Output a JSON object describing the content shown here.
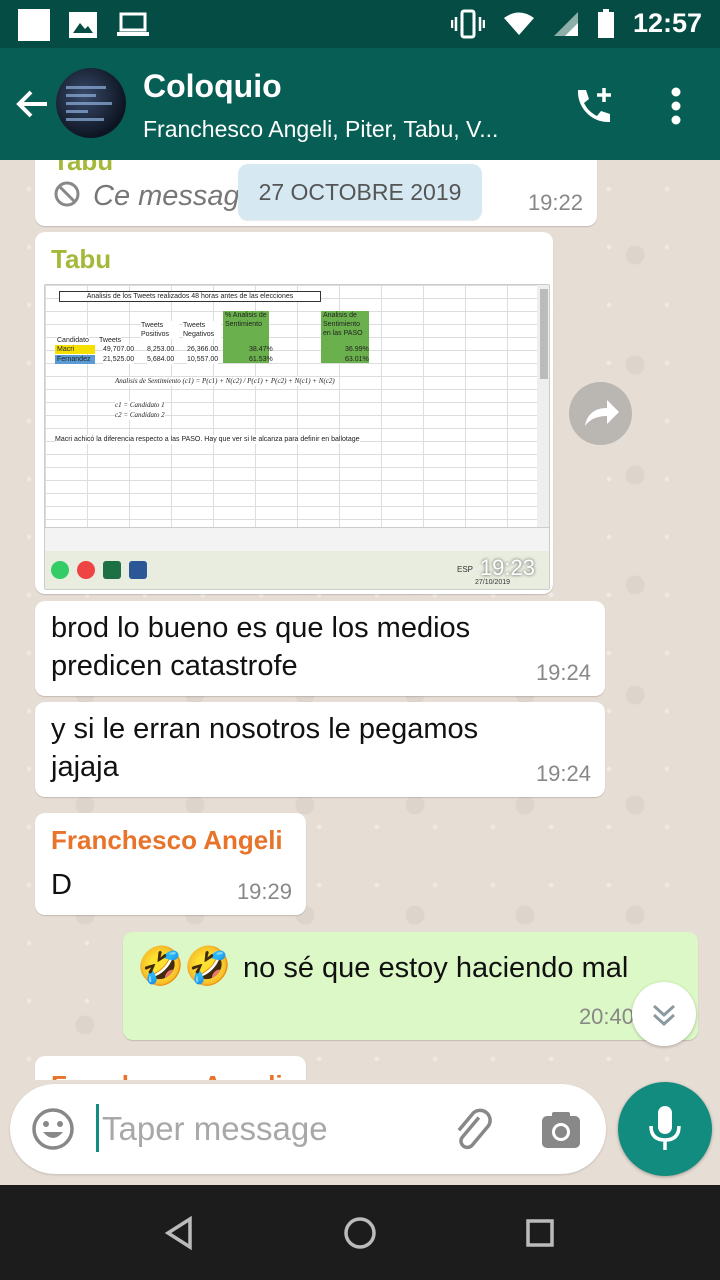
{
  "status_bar": {
    "time": "12:57"
  },
  "header": {
    "title": "Coloquio",
    "subtitle": "Franchesco Angeli, Piter, Tabu, V..."
  },
  "date_chip": "27 OCTOBRE 2019",
  "messages": [
    {
      "sender": "Tabu",
      "text": "Ce message a été supprimé",
      "time": "19:22",
      "deleted": true
    },
    {
      "sender": "Tabu",
      "type": "image",
      "time": "19:23",
      "image": {
        "title": "Analisis de los Tweets realizados 48 horas antes de las elecciones",
        "headers": [
          "Candidato",
          "Tweets",
          "Tweets Positivos",
          "Tweets Negativos",
          "% Analisis de Sentimiento",
          "Analisis de Sentimiento en las PASO"
        ],
        "rows": [
          [
            "Macri",
            "49,707.00",
            "8,253.00",
            "26,366.00",
            "38.47%",
            "36.99%"
          ],
          [
            "Fernandez",
            "21,525.00",
            "5,684.00",
            "10,557.00",
            "61.53%",
            "63.01%"
          ]
        ],
        "formula": "Analisis de Sentimiento (c1) = P(c1) + N(c2) / P(c1) + P(c2) + N(c1) + N(c2)",
        "c1": "c1 = Candidato 1",
        "c2": "c2 = Candidato 2",
        "note": "Macri achicó la diferencia respecto a las PASO. Hay que ver si le alcanza para definir en ballotage",
        "taskbar_lang": "ESP",
        "taskbar_date": "27/10/2019"
      }
    },
    {
      "text": "brod lo bueno es que los medios predicen catastrofe",
      "time": "19:24"
    },
    {
      "text": "y si le erran nosotros le pegamos jajaja",
      "time": "19:24"
    },
    {
      "sender": "Franchesco Angeli",
      "text": "D",
      "time": "19:29"
    },
    {
      "outgoing": true,
      "emoji": "🤣🤣",
      "text": "no sé que estoy haciendo mal",
      "time": "20:40"
    },
    {
      "sender": "Franchesco Angeli",
      "partial": true
    }
  ],
  "input": {
    "placeholder": "Taper message"
  },
  "colors": {
    "header": "#075e54",
    "status": "#054d44",
    "accent": "#128c7e",
    "outgoing": "#dcf8c6",
    "tabu": "#a5b83a",
    "franchesco": "#e8732a"
  }
}
